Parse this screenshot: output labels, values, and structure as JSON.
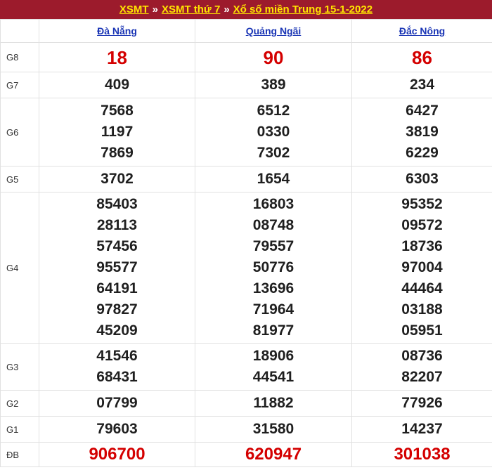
{
  "breadcrumb": {
    "link1": "XSMT",
    "sep": "»",
    "link2": "XSMT thứ 7",
    "link3": "Xổ số miền Trung 15-1-2022"
  },
  "provinces": [
    "Đà Nẵng",
    "Quảng Ngãi",
    "Đắc Nông"
  ],
  "prizes": [
    {
      "label": "G8",
      "values": [
        [
          "18"
        ],
        [
          "90"
        ],
        [
          "86"
        ]
      ]
    },
    {
      "label": "G7",
      "values": [
        [
          "409"
        ],
        [
          "389"
        ],
        [
          "234"
        ]
      ]
    },
    {
      "label": "G6",
      "values": [
        [
          "7568",
          "1197",
          "7869"
        ],
        [
          "6512",
          "0330",
          "7302"
        ],
        [
          "6427",
          "3819",
          "6229"
        ]
      ]
    },
    {
      "label": "G5",
      "values": [
        [
          "3702"
        ],
        [
          "1654"
        ],
        [
          "6303"
        ]
      ]
    },
    {
      "label": "G4",
      "values": [
        [
          "85403",
          "28113",
          "57456",
          "95577",
          "64191",
          "97827",
          "45209"
        ],
        [
          "16803",
          "08748",
          "79557",
          "50776",
          "13696",
          "71964",
          "81977"
        ],
        [
          "95352",
          "09572",
          "18736",
          "97004",
          "44464",
          "03188",
          "05951"
        ]
      ]
    },
    {
      "label": "G3",
      "values": [
        [
          "41546",
          "68431"
        ],
        [
          "18906",
          "44541"
        ],
        [
          "08736",
          "82207"
        ]
      ]
    },
    {
      "label": "G2",
      "values": [
        [
          "07799"
        ],
        [
          "11882"
        ],
        [
          "77926"
        ]
      ]
    },
    {
      "label": "G1",
      "values": [
        [
          "79603"
        ],
        [
          "31580"
        ],
        [
          "14237"
        ]
      ]
    },
    {
      "label": "ĐB",
      "values": [
        [
          "906700"
        ],
        [
          "620947"
        ],
        [
          "301038"
        ]
      ]
    }
  ],
  "colors": {
    "header_bg": "#9c1b2c",
    "link_yellow": "#ffe600",
    "province_link": "#1a35b5",
    "highlight_red": "#d40000"
  }
}
